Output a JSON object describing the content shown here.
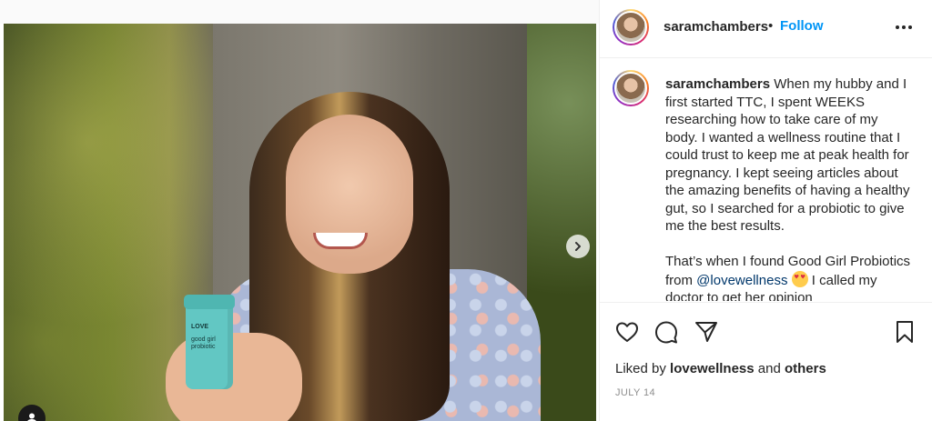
{
  "post": {
    "username": "saramchambers",
    "separator": "•",
    "follow_label": "Follow",
    "more_icon": "more-horizontal-icon"
  },
  "media": {
    "bottle_brand": "LOVE",
    "bottle_product_line1": "good girl",
    "bottle_product_line2": "probiotic",
    "next_icon": "chevron-right-icon",
    "tag_icon": "user-tag-icon",
    "carousel_total": 2,
    "carousel_active": 1
  },
  "caption": {
    "username": "saramchambers",
    "paragraph1": "When my hubby and I first started TTC, I spent WEEKS researching how to take care of my body. I wanted a wellness routine that I could trust to keep me at peak health for pregnancy. I kept seeing articles about the amazing benefits of having a healthy gut, so I searched for a probiotic to give me the best results.",
    "paragraph2_start": "That’s when I found Good Girl Probiotics from ",
    "mention": "@lovewellness",
    "emoji": "heart-eyes-emoji",
    "paragraph2_end": " I called my doctor to get her opinion"
  },
  "actions": {
    "like_icon": "heart-icon",
    "comment_icon": "comment-icon",
    "share_icon": "share-icon",
    "save_icon": "bookmark-icon",
    "liked_by_prefix": "Liked by ",
    "liked_by_user": "lovewellness",
    "liked_by_and": " and ",
    "liked_by_others": "others",
    "date": "JULY 14"
  }
}
